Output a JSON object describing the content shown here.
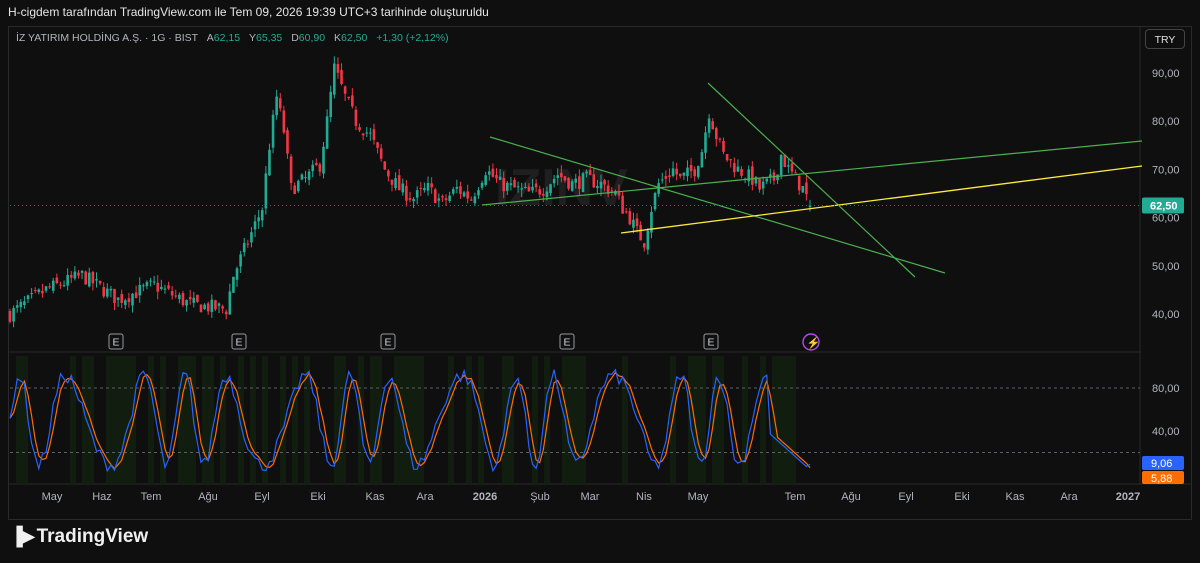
{
  "header": {
    "title": "H-cigdem tarafından TradingView.com ile Tem 09, 2026 19:39 UTC+3 tarihinde oluşturuldu"
  },
  "legend": {
    "symbol": "İZ YATIRIM HOLDİNG A.Ş. · 1G · BIST",
    "open_label": "A",
    "open": "62,15",
    "high_label": "Y",
    "high": "65,35",
    "low_label": "D",
    "low": "60,90",
    "close_label": "K",
    "close": "62,50",
    "change": "+1,30 (+2,12%)"
  },
  "currency_button": "TRY",
  "watermark": "IZINV",
  "branding": {
    "logo_text": "TradingView"
  },
  "colors": {
    "up": "#22ab94",
    "down": "#f23645",
    "stoch_k": "#2962ff",
    "stoch_d": "#ff6d00",
    "trend_green": "#4caf50",
    "trend_yellow": "#ffeb3b",
    "price_label": "#22ab94"
  },
  "chart_data": [
    {
      "type": "candlestick",
      "symbol": "IZINV",
      "ylim": [
        37,
        93
      ],
      "y_ticks": [
        "90,00",
        "80,00",
        "70,00",
        "60,00",
        "50,00",
        "40,00"
      ],
      "x_ticks": [
        "May",
        "Haz",
        "Tem",
        "Ağu",
        "Eyl",
        "Eki",
        "Kas",
        "Ara",
        "2026",
        "Şub",
        "Mar",
        "Nis",
        "May",
        "Tem",
        "Ağu",
        "Eyl",
        "Eki",
        "Kas",
        "Ara",
        "2027"
      ],
      "last_price_label": "62,50",
      "earnings_markers": [
        "E",
        "E",
        "E",
        "E",
        "E"
      ],
      "dividend_marker": "⚡",
      "close_path": [
        [
          0,
          40
        ],
        [
          10,
          45
        ],
        [
          20,
          48
        ],
        [
          30,
          43
        ],
        [
          40,
          46
        ],
        [
          50,
          42
        ],
        [
          60,
          41
        ],
        [
          62,
          48
        ],
        [
          66,
          55
        ],
        [
          70,
          62
        ],
        [
          72,
          75
        ],
        [
          74,
          85
        ],
        [
          76,
          78
        ],
        [
          78,
          66
        ],
        [
          82,
          68
        ],
        [
          86,
          71
        ],
        [
          88,
          80
        ],
        [
          90,
          91
        ],
        [
          93,
          85
        ],
        [
          96,
          80
        ],
        [
          100,
          77
        ],
        [
          104,
          70
        ],
        [
          108,
          66
        ],
        [
          112,
          64
        ],
        [
          116,
          66
        ],
        [
          120,
          63
        ],
        [
          124,
          66
        ],
        [
          128,
          64
        ],
        [
          132,
          70
        ],
        [
          136,
          67
        ],
        [
          140,
          66
        ],
        [
          144,
          65
        ],
        [
          148,
          66
        ],
        [
          152,
          69
        ],
        [
          156,
          67
        ],
        [
          160,
          68
        ],
        [
          164,
          67
        ],
        [
          168,
          65
        ],
        [
          170,
          62
        ],
        [
          172,
          60
        ],
        [
          174,
          57
        ],
        [
          176,
          55
        ],
        [
          178,
          62
        ],
        [
          180,
          67
        ],
        [
          184,
          70
        ],
        [
          186,
          68
        ],
        [
          190,
          70
        ],
        [
          192,
          74
        ],
        [
          194,
          82
        ],
        [
          196,
          77
        ],
        [
          198,
          73
        ],
        [
          202,
          70
        ],
        [
          206,
          68
        ],
        [
          208,
          66
        ],
        [
          212,
          68
        ],
        [
          214,
          73
        ],
        [
          216,
          70
        ],
        [
          220,
          66
        ],
        [
          222,
          62.5
        ]
      ]
    },
    {
      "type": "line",
      "indicator": "stochastic",
      "ylim": [
        0,
        100
      ],
      "y_ticks": [
        "80,00",
        "40,00"
      ],
      "bands": [
        80,
        20
      ],
      "series": [
        {
          "name": "",
          "last_value": "9,06"
        },
        {
          "name": "",
          "last_value": "5,88"
        }
      ]
    }
  ]
}
